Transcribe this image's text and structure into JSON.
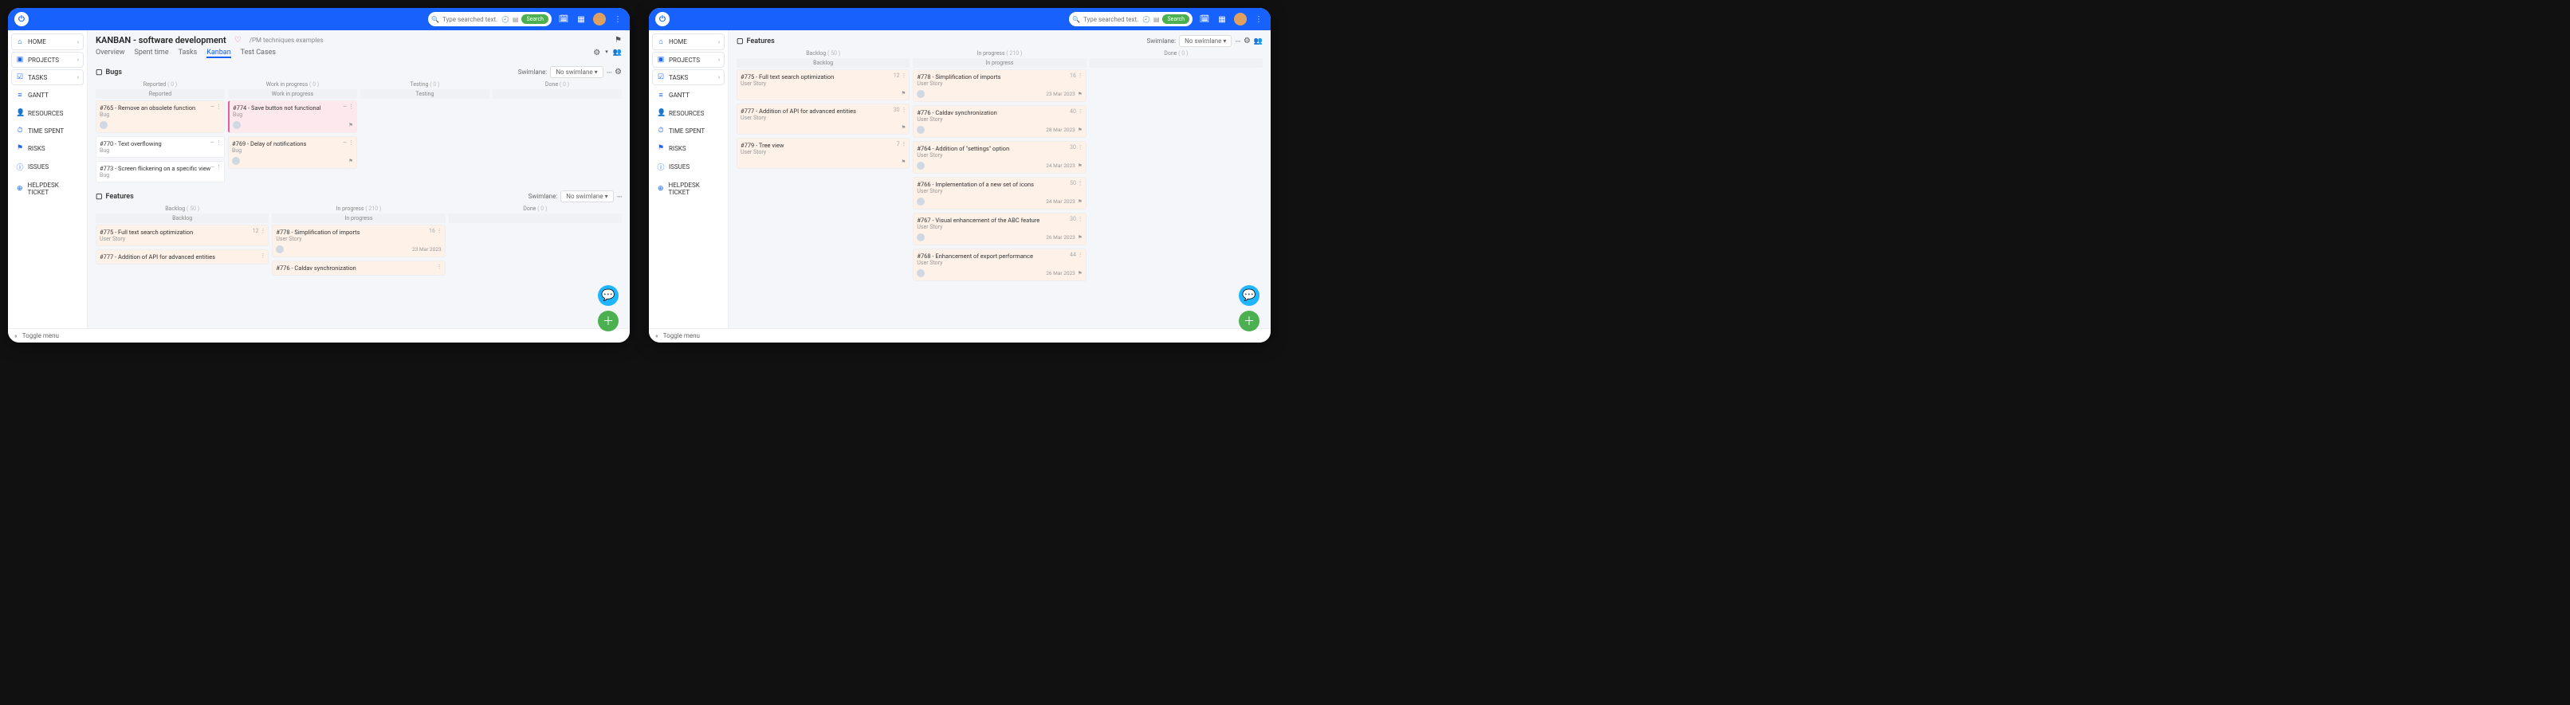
{
  "search_placeholder": "Type searched text...",
  "search_btn": "Search",
  "nav": {
    "home": "HOME",
    "projects": "PROJECTS",
    "tasks": "TASKS",
    "gantt": "GANTT",
    "resources": "RESOURCES",
    "time": "TIME SPENT",
    "risks": "RISKS",
    "issues": "ISSUES",
    "helpdesk": "HELPDESK TICKET"
  },
  "left": {
    "title": "KANBAN - software development",
    "breadcrumb": "/PM techniques examples",
    "tabs": [
      "Overview",
      "Spent time",
      "Tasks",
      "Kanban",
      "Test Cases"
    ],
    "active_tab": "Kanban",
    "swimlane_label": "Swimlane:",
    "swimlane_value": "No swimlane",
    "toggle_menu": "Toggle menu",
    "bugs": {
      "title": "Bugs",
      "cols": [
        {
          "head": "Reported",
          "count": "( 0 )",
          "sub": "Reported"
        },
        {
          "head": "Work in progress",
          "count": "( 0 )",
          "sub": "Work in progress"
        },
        {
          "head": "Testing",
          "count": "( 0 )",
          "sub": "Testing"
        },
        {
          "head": "Done",
          "count": "( 0 )"
        }
      ],
      "reported": [
        {
          "t": "#765 - Remove an obsolete function",
          "s": "Bug"
        },
        {
          "t": "#770 - Text overflowing",
          "s": "Bug"
        },
        {
          "t": "#773 - Screen flickering on a specific view",
          "s": "Bug"
        }
      ],
      "wip": [
        {
          "t": "#774 - Save button not functional",
          "s": "Bug",
          "cls": "pink"
        },
        {
          "t": "#769 - Delay of notifications",
          "s": "Bug",
          "cls": "peach"
        }
      ]
    },
    "features": {
      "title": "Features",
      "cols": [
        {
          "head": "Backlog",
          "count": "( 50 )",
          "sub": "Backlog"
        },
        {
          "head": "In progress",
          "count": "( 210 )",
          "sub": "In progress"
        },
        {
          "head": "Done",
          "count": "( 0 )"
        }
      ],
      "backlog": [
        {
          "t": "#775 - Full text search optimization",
          "s": "User Story",
          "n": "12"
        },
        {
          "t": "#777 - Addition of API for advanced entities",
          "s": "",
          "n": ""
        }
      ],
      "inprog": [
        {
          "t": "#778 - Simplification of imports",
          "s": "User Story",
          "n": "16",
          "d": "23 Mar 2023"
        },
        {
          "t": "#776 - Caldav synchronization",
          "s": "",
          "n": "",
          "d": ""
        }
      ]
    }
  },
  "right": {
    "swimlane_label": "Swimlane:",
    "swimlane_value": "No swimlane",
    "features": {
      "title": "Features",
      "cols": [
        {
          "head": "Backlog",
          "count": "( 50 )",
          "sub": "Backlog"
        },
        {
          "head": "In progress",
          "count": "( 210 )",
          "sub": "In progress"
        },
        {
          "head": "Done",
          "count": "( 0 )"
        }
      ],
      "backlog": [
        {
          "t": "#775 - Full text search optimization",
          "s": "User Story",
          "n": "12"
        },
        {
          "t": "#777 - Addition of API for advanced entities",
          "s": "User Story",
          "n": "30"
        },
        {
          "t": "#779 - Tree view",
          "s": "User Story",
          "n": "7"
        }
      ],
      "inprog": [
        {
          "t": "#778 - Simplification of imports",
          "s": "User Story",
          "n": "16",
          "d": "23 Mar 2023"
        },
        {
          "t": "#776 - Caldav synchronization",
          "s": "User Story",
          "n": "40",
          "d": "28 Mar 2023"
        },
        {
          "t": "#764 - Addition of \"settings\" option",
          "s": "User Story",
          "n": "30",
          "d": "24 Mar 2023"
        },
        {
          "t": "#766 - Implementation of a new set of icons",
          "s": "User Story",
          "n": "50",
          "d": "24 Mar 2023"
        },
        {
          "t": "#767 - Visual enhancement of the ABC feature",
          "s": "User Story",
          "n": "30",
          "d": "26 Mar 2023"
        },
        {
          "t": "#768 - Enhancement of export performance",
          "s": "User Story",
          "n": "44",
          "d": "26 Mar 2023"
        }
      ]
    },
    "toggle_menu": "Toggle menu"
  }
}
